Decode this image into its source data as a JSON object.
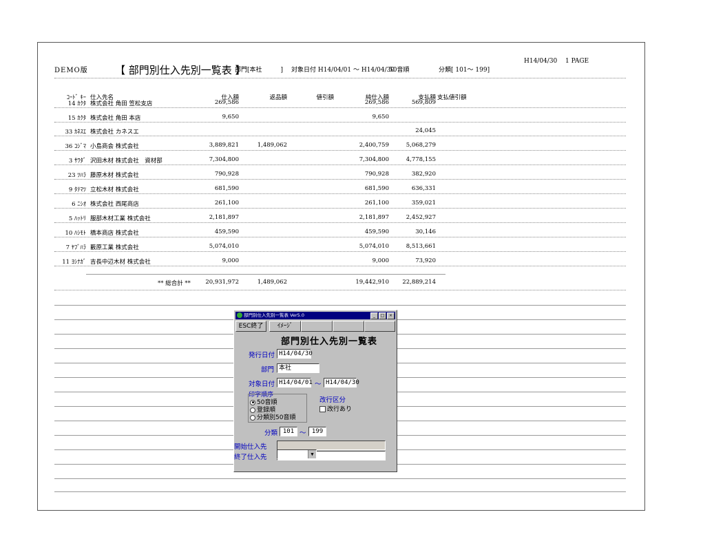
{
  "report": {
    "demo": "DEMO版",
    "title": "【 部門別仕入先別一覧表 】",
    "dept": "部門[本社　　　]",
    "target": "対象日付 H14/04/01 ～ H14/04/30",
    "order": "50音順",
    "category": "分類[ 101～ 199]",
    "date": "H14/04/30",
    "page": "1 PAGE",
    "headers": {
      "code": "ｺｰﾄﾞ ｷｰ",
      "name": "仕入先名",
      "shiire": "仕入額",
      "henpin": "返品額",
      "nebiki": "値引額",
      "jun": "純仕入額",
      "shiharai": "支払額",
      "shnebiki": "支払値引額"
    },
    "rows": [
      {
        "code": "14 ｶｸﾀ",
        "name": "株式会社 角田 笠松支店",
        "shiire": "269,586",
        "henpin": "",
        "jun": "269,586",
        "shiharai": "569,809"
      },
      {
        "code": "15 ｶｸﾀ",
        "name": "株式会社 角田 本店",
        "shiire": "9,650",
        "henpin": "",
        "jun": "9,650",
        "shiharai": ""
      },
      {
        "code": "33 ｶﾈｽｴ",
        "name": "株式会社 カネスエ",
        "shiire": "",
        "henpin": "",
        "jun": "",
        "shiharai": "24,045"
      },
      {
        "code": "36 ｺｼﾞﾏ",
        "name": "小島商会 株式会社",
        "shiire": "3,889,821",
        "henpin": "1,489,062",
        "jun": "2,400,759",
        "shiharai": "5,068,279"
      },
      {
        "code": "3 ｻﾜﾀﾞ",
        "name": "沢田木材 株式会社　資材部",
        "shiire": "7,304,800",
        "henpin": "",
        "jun": "7,304,800",
        "shiharai": "4,778,155"
      },
      {
        "code": "23 ﾂﾊﾗ",
        "name": "藤原木材 株式会社",
        "shiire": "790,928",
        "henpin": "",
        "jun": "790,928",
        "shiharai": "382,920"
      },
      {
        "code": "9 ﾀﾃﾏﾂ",
        "name": "立松木材 株式会社",
        "shiire": "681,590",
        "henpin": "",
        "jun": "681,590",
        "shiharai": "636,331"
      },
      {
        "code": "6 ﾆｼｵ",
        "name": "株式会社 西尾商店",
        "shiire": "261,100",
        "henpin": "",
        "jun": "261,100",
        "shiharai": "359,021"
      },
      {
        "code": "5 ﾊｯﾄﾘ",
        "name": "服部木材工業 株式会社",
        "shiire": "2,181,897",
        "henpin": "",
        "jun": "2,181,897",
        "shiharai": "2,452,927"
      },
      {
        "code": "10 ﾊｼﾓﾄ",
        "name": "橋本商店 株式会社",
        "shiire": "459,590",
        "henpin": "",
        "jun": "459,590",
        "shiharai": "30,146"
      },
      {
        "code": "7 ﾔﾌﾞﾊﾗ",
        "name": "藪原工業 株式会社",
        "shiire": "5,074,010",
        "henpin": "",
        "jun": "5,074,010",
        "shiharai": "8,513,661"
      },
      {
        "code": "11 ﾖｼﾅｶﾞ",
        "name": "吉長中辺木材 株式会社",
        "shiire": "9,000",
        "henpin": "",
        "jun": "9,000",
        "shiharai": "73,920"
      }
    ],
    "total": {
      "label": "** 総合計 **",
      "shiire": "20,931,972",
      "henpin": "1,489,062",
      "jun": "19,442,910",
      "shiharai": "22,889,214"
    }
  },
  "dialog": {
    "window_title": "部門別仕入先別一覧表 Ver5.0",
    "btn_min": "_",
    "btn_max": "□",
    "btn_close": "×",
    "btn_esc": "ESC終了",
    "btn_image": "ｲﾒｰｼﾞ",
    "heading": "部門別仕入先別一覧表",
    "issue_label": "発行日付",
    "issue_value": "H14/04/30",
    "dept_label": "部門",
    "dept_value": "本社",
    "target_label": "対象日付",
    "target_from": "H14/04/01",
    "tilde": "～",
    "target_to": "H14/04/30",
    "print_order_label": "印字順序",
    "radio_1": "50音順",
    "radio_2": "登録順",
    "radio_3": "分類別50音順",
    "page_break_label": "改行区分",
    "page_break_check": "改行あり",
    "category_label": "分類",
    "category_from": "101",
    "category_to": "199",
    "start_supplier_label": "開始仕入先",
    "end_supplier_label": "終了仕入先",
    "dropdown_arrow": "▼"
  }
}
